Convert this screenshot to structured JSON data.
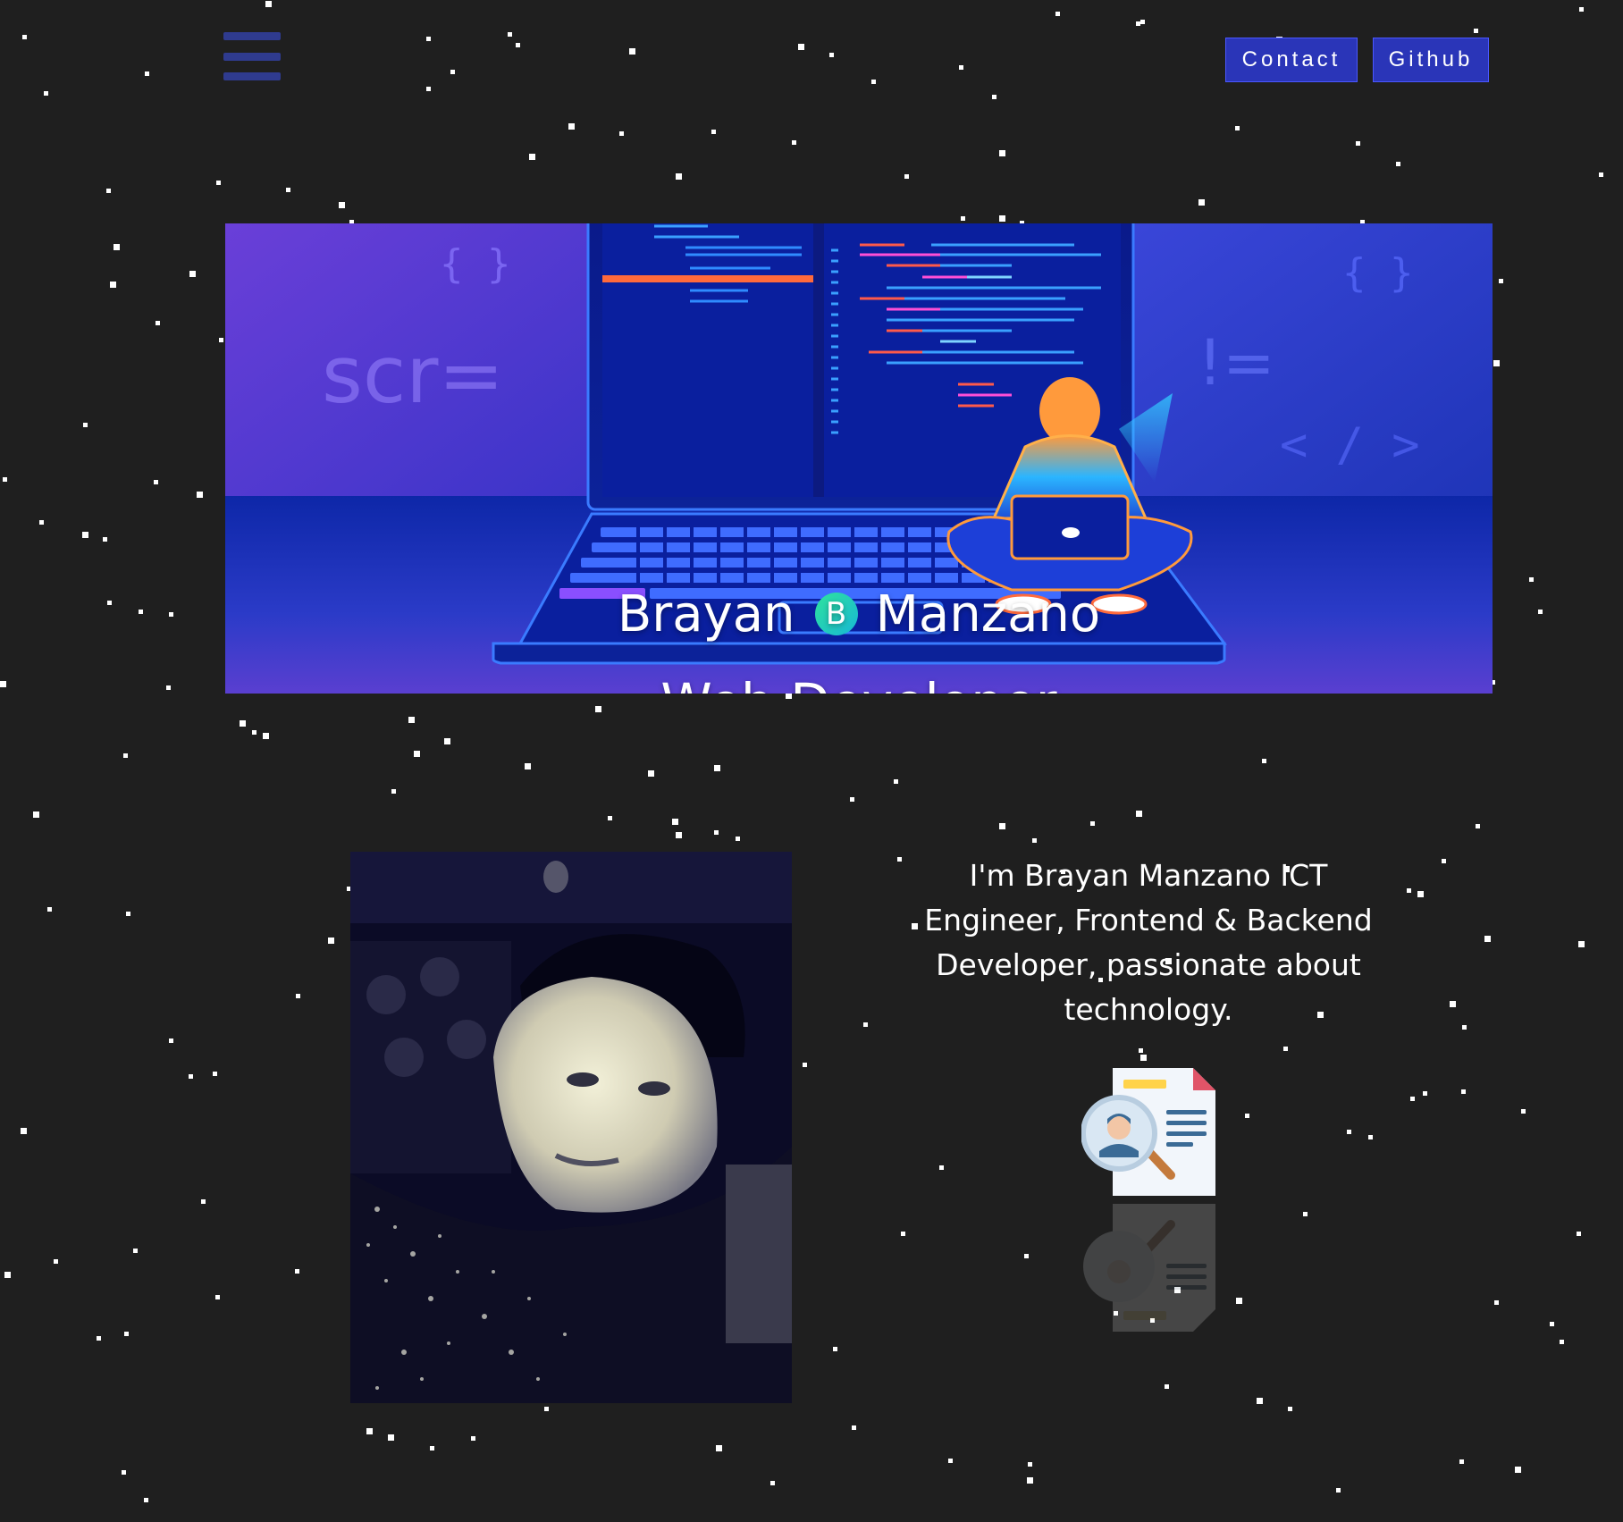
{
  "header": {
    "menu_icon": "hamburger-menu-icon",
    "contact_label": "Contact",
    "github_label": "Github"
  },
  "hero": {
    "first_name": "Brayan",
    "logo_letter": "B",
    "last_name": "Manzano",
    "subtitle": "Web Developer",
    "code_symbols": [
      "{ }",
      "scr=",
      "{ }",
      "!=",
      "< / >"
    ]
  },
  "about": {
    "text": "I'm Brayan Manzano ICT Engineer, Frontend & Backend Developer, passionate about technology.",
    "resume_icon": "resume-search-icon"
  },
  "colors": {
    "background": "#1f1f1f",
    "button": "#2a35b8",
    "hero_left": "#6a3fd8",
    "hero_right": "#1a2fbf",
    "logo_gradient": "#2fe39c"
  }
}
